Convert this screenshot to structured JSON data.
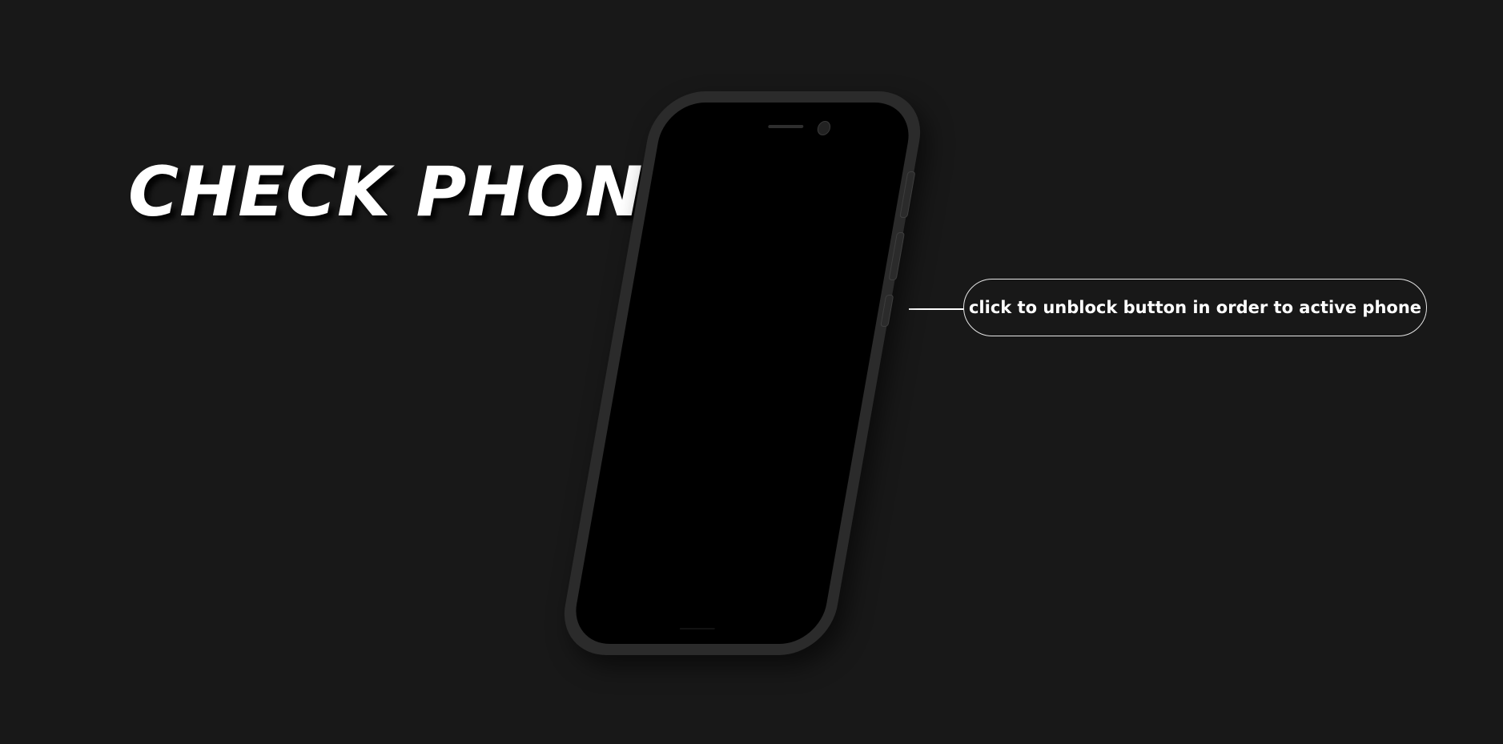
{
  "page": {
    "title": "CHECK PHONE",
    "background_color": "#181818"
  },
  "phone": {
    "screen_state": "off",
    "body_color": "#2b2b2b",
    "screen_color": "#000000",
    "unlock_button_icon": "side-power-button"
  },
  "hint": {
    "text": "click to unblock button in order to active phone",
    "border_color": "#e6e6e6"
  }
}
